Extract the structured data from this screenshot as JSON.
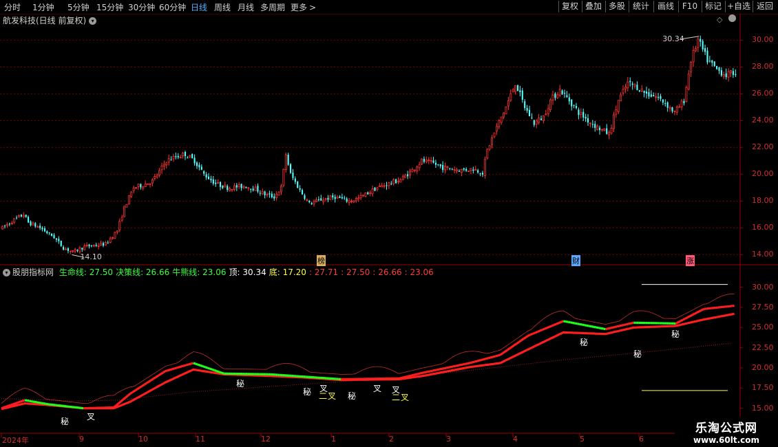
{
  "toolbar": {
    "periods": [
      "分时",
      "1分钟",
      "5分钟",
      "15分钟",
      "30分钟",
      "60分钟",
      "日线",
      "周线",
      "月线",
      "多周期",
      "更多"
    ],
    "active_period": "日线",
    "more_arrow": ">",
    "buttons": [
      "复权",
      "叠加",
      "多股",
      "统计",
      "画线",
      "F10",
      "标记",
      "+自选",
      "返回"
    ]
  },
  "main_chart": {
    "title": "航发科技(日线 前复权)",
    "title_icon": "chevron-down-icon",
    "pin_icon": "diamond-icon",
    "y_ticks": [
      "30.00",
      "28.00",
      "26.00",
      "24.00",
      "22.00",
      "20.00",
      "18.00",
      "16.00",
      "14.00"
    ],
    "high_label": "30.34",
    "low_label": "14.10",
    "markers": [
      "榜",
      "财",
      "涨"
    ],
    "colors": {
      "up": "#ff3232",
      "down": "#54ffff",
      "grid": "#7a0000",
      "axis": "#9a0000"
    }
  },
  "indicator": {
    "name": "股朋指标网",
    "legend": [
      {
        "text": "生命线: 27.50",
        "color": "#3cff3c"
      },
      {
        "text": "决策线: 26.66",
        "color": "#3cff3c"
      },
      {
        "text": "牛熊线: 23.06",
        "color": "#3cff3c"
      },
      {
        "text": "顶: 30.34",
        "color": "#ffffff"
      },
      {
        "text": "底: 17.20",
        "color": "#ffff3c"
      },
      {
        "text": ": 27.71",
        "color": "#ff3c3c"
      },
      {
        "text": ": 27.50",
        "color": "#ff3c3c"
      },
      {
        "text": ": 26.66",
        "color": "#ff3c3c"
      },
      {
        "text": ": 23.06",
        "color": "#ff3c3c"
      }
    ],
    "y_ticks": [
      "30.00",
      "27.50",
      "25.00",
      "22.50",
      "20.00",
      "17.50",
      "15.00"
    ],
    "annotations": {
      "mi": "秘",
      "cha": "叉",
      "er": "二"
    }
  },
  "x_axis": {
    "labels": [
      "2024年",
      "9",
      "10",
      "11",
      "12",
      "1",
      "2",
      "3",
      "4",
      "5",
      "6"
    ]
  },
  "watermark": {
    "title": "乐淘公式网",
    "url": "www.60lt.com"
  },
  "chart_data": [
    {
      "type": "candlestick",
      "title": "航发科技(日线 前复权)",
      "y_ticks": [
        14,
        16,
        18,
        20,
        22,
        24,
        26,
        28,
        30
      ],
      "ylim": [
        13.3,
        31.2
      ],
      "x_labels": [
        "2024年",
        "9",
        "10",
        "11",
        "12",
        "1",
        "2",
        "3",
        "4",
        "5",
        "6"
      ],
      "trend_points": [
        {
          "d": 0,
          "p": 16.0
        },
        {
          "d": 5,
          "p": 16.6
        },
        {
          "d": 9,
          "p": 17.0
        },
        {
          "d": 11,
          "p": 16.4
        },
        {
          "d": 16,
          "p": 16.0
        },
        {
          "d": 22,
          "p": 15.3
        },
        {
          "d": 26,
          "p": 14.5
        },
        {
          "d": 30,
          "p": 14.2
        },
        {
          "d": 35,
          "p": 14.6
        },
        {
          "d": 40,
          "p": 14.7
        },
        {
          "d": 44,
          "p": 14.8
        },
        {
          "d": 49,
          "p": 15.8
        },
        {
          "d": 52,
          "p": 17.5
        },
        {
          "d": 56,
          "p": 19.0
        },
        {
          "d": 60,
          "p": 19.2
        },
        {
          "d": 64,
          "p": 19.5
        },
        {
          "d": 67,
          "p": 20.2
        },
        {
          "d": 70,
          "p": 21.0
        },
        {
          "d": 74,
          "p": 21.3
        },
        {
          "d": 78,
          "p": 21.5
        },
        {
          "d": 82,
          "p": 21.0
        },
        {
          "d": 86,
          "p": 20.0
        },
        {
          "d": 91,
          "p": 19.3
        },
        {
          "d": 96,
          "p": 19.0
        },
        {
          "d": 104,
          "p": 19.1
        },
        {
          "d": 108,
          "p": 18.9
        },
        {
          "d": 112,
          "p": 18.5
        },
        {
          "d": 116,
          "p": 18.3
        },
        {
          "d": 119,
          "p": 19.0
        },
        {
          "d": 121,
          "p": 21.5
        },
        {
          "d": 123,
          "p": 20.0
        },
        {
          "d": 127,
          "p": 18.8
        },
        {
          "d": 131,
          "p": 17.8
        },
        {
          "d": 136,
          "p": 18.1
        },
        {
          "d": 142,
          "p": 18.3
        },
        {
          "d": 148,
          "p": 18.0
        },
        {
          "d": 152,
          "p": 18.2
        },
        {
          "d": 156,
          "p": 18.6
        },
        {
          "d": 160,
          "p": 19.0
        },
        {
          "d": 165,
          "p": 19.3
        },
        {
          "d": 170,
          "p": 19.6
        },
        {
          "d": 175,
          "p": 20.3
        },
        {
          "d": 179,
          "p": 21.0
        },
        {
          "d": 184,
          "p": 20.8
        },
        {
          "d": 188,
          "p": 20.5
        },
        {
          "d": 196,
          "p": 20.3
        },
        {
          "d": 201,
          "p": 20.4
        },
        {
          "d": 205,
          "p": 20.1
        },
        {
          "d": 207,
          "p": 21.8
        },
        {
          "d": 211,
          "p": 23.5
        },
        {
          "d": 215,
          "p": 25.0
        },
        {
          "d": 219,
          "p": 26.8
        },
        {
          "d": 223,
          "p": 25.0
        },
        {
          "d": 227,
          "p": 23.8
        },
        {
          "d": 231,
          "p": 24.3
        },
        {
          "d": 234,
          "p": 25.5
        },
        {
          "d": 238,
          "p": 26.3
        },
        {
          "d": 242,
          "p": 25.5
        },
        {
          "d": 246,
          "p": 24.6
        },
        {
          "d": 250,
          "p": 24.0
        },
        {
          "d": 254,
          "p": 23.5
        },
        {
          "d": 259,
          "p": 23.0
        },
        {
          "d": 263,
          "p": 25.5
        },
        {
          "d": 267,
          "p": 26.8
        },
        {
          "d": 271,
          "p": 26.5
        },
        {
          "d": 275,
          "p": 26.0
        },
        {
          "d": 279,
          "p": 25.8
        },
        {
          "d": 283,
          "p": 25.3
        },
        {
          "d": 287,
          "p": 24.6
        },
        {
          "d": 291,
          "p": 25.5
        },
        {
          "d": 294,
          "p": 28.5
        },
        {
          "d": 297,
          "p": 30.0
        },
        {
          "d": 301,
          "p": 28.5
        },
        {
          "d": 305,
          "p": 27.8
        },
        {
          "d": 309,
          "p": 27.4
        },
        {
          "d": 313,
          "p": 27.6
        }
      ],
      "annotated_high": 30.34,
      "annotated_low": 14.1
    },
    {
      "type": "line",
      "title": "股朋指标网",
      "y_ticks": [
        15,
        17.5,
        20,
        22.5,
        25,
        27.5,
        30
      ],
      "ylim": [
        14.8,
        31.5
      ],
      "series": [
        {
          "name": "生命线",
          "latest": 27.5,
          "points": [
            [
              0,
              15.0
            ],
            [
              10,
              16.0
            ],
            [
              20,
              15.5
            ],
            [
              35,
              15.0
            ],
            [
              48,
              15.1
            ],
            [
              55,
              16.8
            ],
            [
              70,
              19.6
            ],
            [
              82,
              20.6
            ],
            [
              95,
              19.3
            ],
            [
              115,
              19.2
            ],
            [
              130,
              18.9
            ],
            [
              145,
              18.6
            ],
            [
              170,
              18.7
            ],
            [
              180,
              19.4
            ],
            [
              200,
              20.6
            ],
            [
              213,
              21.6
            ],
            [
              225,
              24.0
            ],
            [
              240,
              25.8
            ],
            [
              258,
              24.8
            ],
            [
              270,
              25.6
            ],
            [
              288,
              25.5
            ],
            [
              300,
              27.3
            ],
            [
              313,
              27.7
            ]
          ]
        },
        {
          "name": "决策线",
          "latest": 26.66,
          "points": [
            [
              0,
              14.9
            ],
            [
              10,
              15.6
            ],
            [
              20,
              15.4
            ],
            [
              35,
              15.0
            ],
            [
              48,
              15.0
            ],
            [
              55,
              15.8
            ],
            [
              70,
              18.2
            ],
            [
              82,
              19.8
            ],
            [
              95,
              19.2
            ],
            [
              115,
              19.0
            ],
            [
              130,
              18.8
            ],
            [
              145,
              18.5
            ],
            [
              170,
              18.6
            ],
            [
              180,
              19.0
            ],
            [
              200,
              20.1
            ],
            [
              213,
              20.6
            ],
            [
              225,
              22.3
            ],
            [
              240,
              24.4
            ],
            [
              258,
              24.2
            ],
            [
              270,
              25.0
            ],
            [
              288,
              25.2
            ],
            [
              300,
              26.0
            ],
            [
              313,
              26.7
            ]
          ]
        },
        {
          "name": "牛熊线",
          "latest": 23.06,
          "points": [
            [
              0,
              16.2
            ],
            [
              30,
              15.9
            ],
            [
              50,
              16.0
            ],
            [
              80,
              17.0
            ],
            [
              120,
              17.8
            ],
            [
              170,
              18.8
            ],
            [
              200,
              19.7
            ],
            [
              240,
              21.0
            ],
            [
              280,
              22.1
            ],
            [
              313,
              23.1
            ]
          ]
        }
      ],
      "levels": [
        {
          "name": "顶",
          "value": 30.34
        },
        {
          "name": "底",
          "value": 17.2
        }
      ]
    }
  ]
}
